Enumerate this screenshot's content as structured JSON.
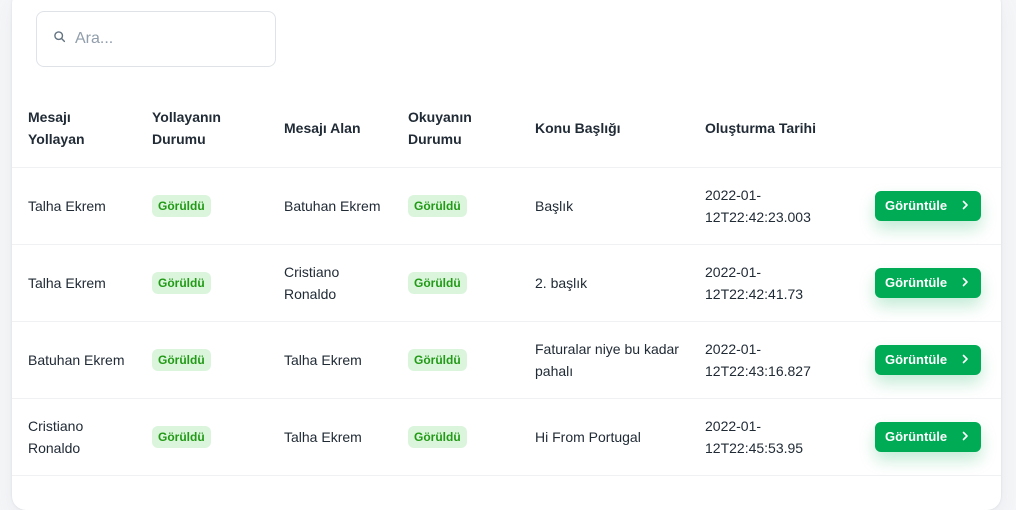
{
  "search": {
    "placeholder": "Ara..."
  },
  "table": {
    "headers": [
      "Mesajı Yollayan",
      "Yollayanın Durumu",
      "Mesajı Alan",
      "Okuyanın Durumu",
      "Konu Başlığı",
      "Oluşturma Tarihi"
    ],
    "rows": [
      {
        "sender": "Talha Ekrem",
        "sender_status": "Görüldü",
        "receiver": "Batuhan Ekrem",
        "reader_status": "Görüldü",
        "subject": "Başlık",
        "created": "2022-01-12T22:42:23.003",
        "action": "Görüntüle"
      },
      {
        "sender": "Talha Ekrem",
        "sender_status": "Görüldü",
        "receiver": "Cristiano Ronaldo",
        "reader_status": "Görüldü",
        "subject": "2. başlık",
        "created": "2022-01-12T22:42:41.73",
        "action": "Görüntüle"
      },
      {
        "sender": "Batuhan Ekrem",
        "sender_status": "Görüldü",
        "receiver": "Talha Ekrem",
        "reader_status": "Görüldü",
        "subject": "Faturalar niye bu kadar pahalı",
        "created": "2022-01-12T22:43:16.827",
        "action": "Görüntüle"
      },
      {
        "sender": "Cristiano Ronaldo",
        "sender_status": "Görüldü",
        "receiver": "Talha Ekrem",
        "reader_status": "Görüldü",
        "subject": "Hi From Portugal",
        "created": "2022-01-12T22:45:53.95",
        "action": "Görüntüle"
      }
    ]
  },
  "colors": {
    "primary": "#00ab55",
    "badge_bg": "#dbf5dd",
    "badge_text": "#229a16",
    "placeholder": "#919eab"
  },
  "icons": {
    "search": "search-icon",
    "action": "chevron-right-icon"
  }
}
